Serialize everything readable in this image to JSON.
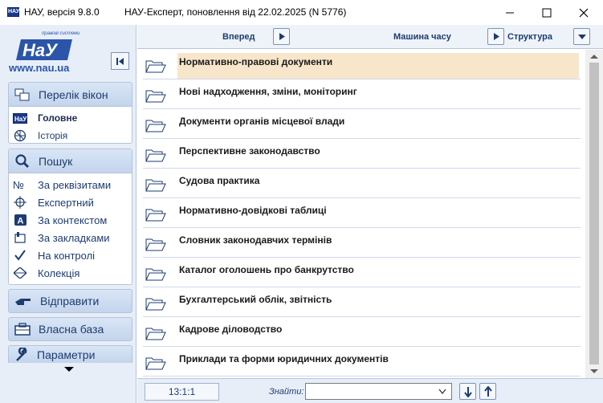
{
  "window": {
    "app_title": "НАУ, версія 9.8.0",
    "doc_title": "НАУ-Експерт, поновлення від 22.02.2025 (N 5776)",
    "icon_text": "НАУ"
  },
  "logo": {
    "tagline": "правові системи",
    "brand": "НаУ",
    "url": "www.nau.ua"
  },
  "sidebar": {
    "windows": {
      "header": "Перелік вікон",
      "items": [
        {
          "label": "Головне",
          "icon": "nau-home-icon"
        },
        {
          "label": "Історія",
          "icon": "history-icon"
        }
      ]
    },
    "search": {
      "header": "Пошук",
      "items": [
        {
          "label": "За реквізитами",
          "icon": "number-sign-icon"
        },
        {
          "label": "Експертний",
          "icon": "crosshair-icon"
        },
        {
          "label": "За контекстом",
          "icon": "letter-a-icon"
        },
        {
          "label": "За закладками",
          "icon": "bookmark-icon"
        },
        {
          "label": "На контролі",
          "icon": "checkmark-icon"
        },
        {
          "label": "Колекція",
          "icon": "diamond-icon"
        }
      ]
    },
    "send": "Відправити",
    "own_base": "Власна база",
    "params": "Параметри"
  },
  "toolbar": {
    "forward": "Вперед",
    "time_machine": "Машина часу",
    "structure": "Структура"
  },
  "list": {
    "items": [
      "Нормативно-правові документи",
      "Нові надходження, зміни, моніторинг",
      "Документи органів місцевої влади",
      "Перспективне законодавство",
      "Судова практика",
      "Нормативно-довідкові таблиці",
      "Словник законодавчих термінів",
      "Каталог оголошень про банкрутство",
      "Бухгалтерський облік, звітність",
      "Кадрове діловодство",
      "Приклади та форми юридичних документів"
    ],
    "selected_index": 0
  },
  "status": {
    "position": "13:1:1",
    "find_label": "Знайти:",
    "find_value": ""
  },
  "colors": {
    "accent": "#1d3c70",
    "highlight": "#f8e6cb",
    "panel": "#e7eef8"
  }
}
